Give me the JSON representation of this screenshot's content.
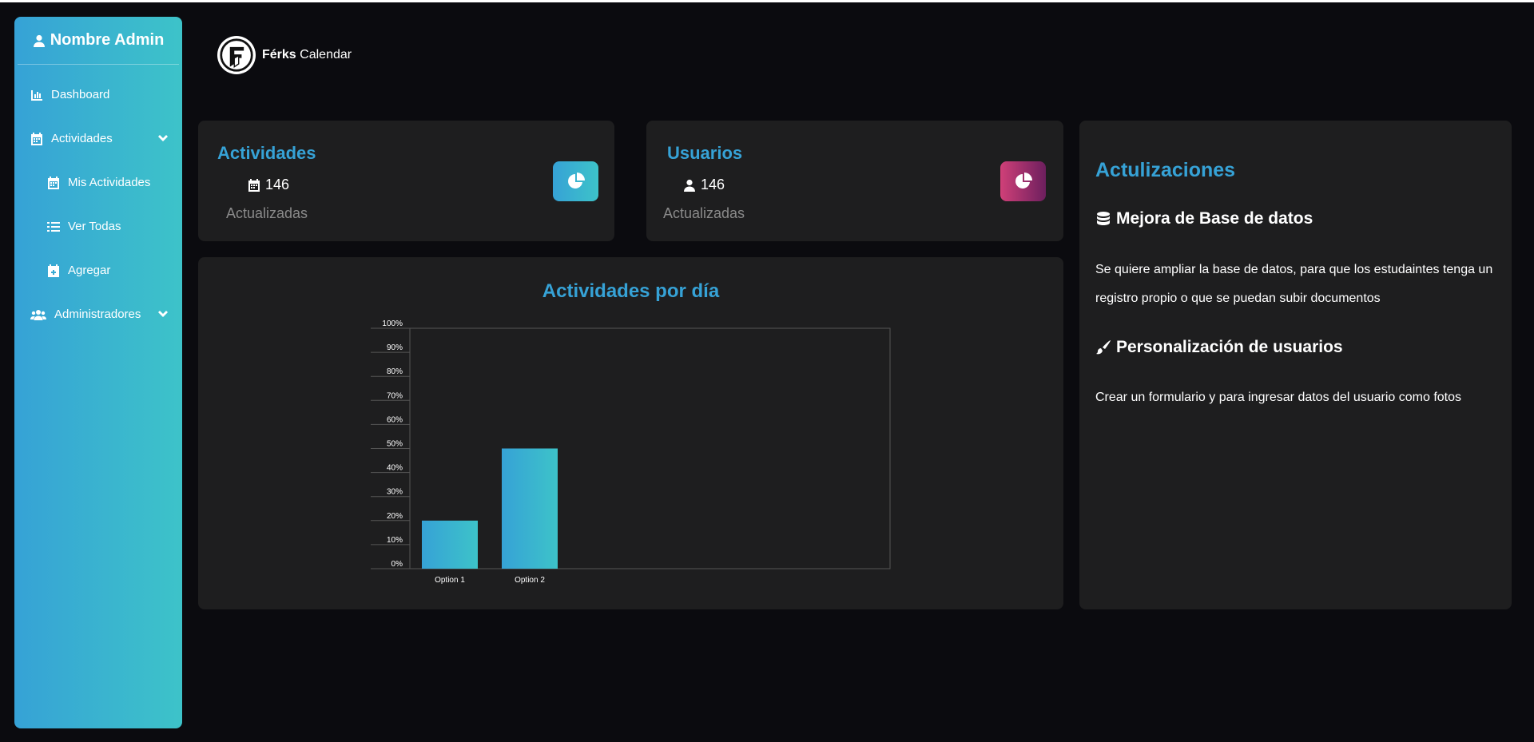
{
  "sidebar": {
    "user_name": "Nombre Admin",
    "items": [
      {
        "label": "Dashboard",
        "icon": "chart-line-icon"
      },
      {
        "label": "Actividades",
        "icon": "calendar-icon",
        "has_submenu": true
      },
      {
        "label": "Mis Actividades",
        "icon": "calendar-icon",
        "sub": true
      },
      {
        "label": "Ver Todas",
        "icon": "list-icon",
        "sub": true
      },
      {
        "label": "Agregar",
        "icon": "calendar-plus-icon",
        "sub": true
      },
      {
        "label": "Administradores",
        "icon": "users-icon",
        "has_submenu": true
      }
    ]
  },
  "logo": {
    "brand_bold": "Férks",
    "brand_rest": "Calendar"
  },
  "cards": {
    "actividades": {
      "title": "Actividades",
      "value": "146",
      "sub": "Actualizadas",
      "icon": "pie-chart-icon"
    },
    "usuarios": {
      "title": "Usuarios",
      "value": "146",
      "sub": "Actualizadas",
      "icon": "pie-chart-icon"
    }
  },
  "updates": {
    "title": "Actulizaciones",
    "items": [
      {
        "heading": "Mejora de Base de datos",
        "icon": "database-icon",
        "text": "Se quiere ampliar la base de datos, para que los estudaintes tenga un registro propio o que se puedan subir documentos"
      },
      {
        "heading": "Personalización de usuarios",
        "icon": "paintbrush-icon",
        "text": "Crear un formulario y para ingresar datos del usuario como fotos"
      }
    ]
  },
  "colors": {
    "accent": "#36a2d6",
    "accent2": "#3dc3c9",
    "pink": "#d04078",
    "purple": "#6d1f5e",
    "card_bg": "#1e1e1f",
    "page_bg": "#0b0b0f"
  },
  "chart_data": {
    "type": "bar",
    "title": "Actividades por día",
    "categories": [
      "Option 1",
      "Option 2"
    ],
    "values": [
      20,
      50
    ],
    "ylim": [
      0,
      100
    ],
    "yticks": [
      "0%",
      "10%",
      "20%",
      "30%",
      "40%",
      "50%",
      "60%",
      "70%",
      "80%",
      "90%",
      "100%"
    ],
    "grid": false
  }
}
